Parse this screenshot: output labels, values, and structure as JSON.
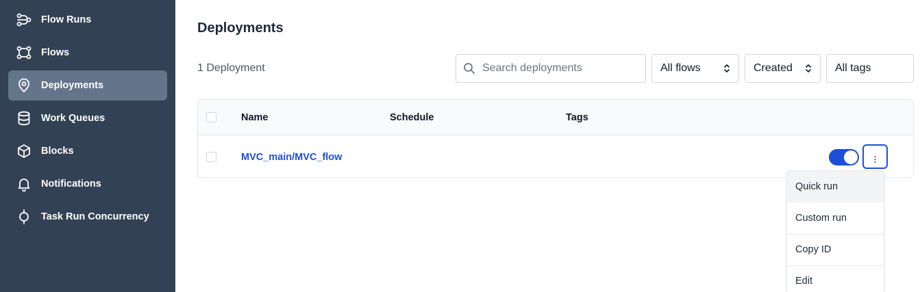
{
  "sidebar": {
    "items": [
      {
        "label": "Flow Runs",
        "icon": "flow-runs-icon"
      },
      {
        "label": "Flows",
        "icon": "flows-icon"
      },
      {
        "label": "Deployments",
        "icon": "map-pin-icon",
        "active": true
      },
      {
        "label": "Work Queues",
        "icon": "database-icon"
      },
      {
        "label": "Blocks",
        "icon": "cube-icon"
      },
      {
        "label": "Notifications",
        "icon": "bell-icon"
      },
      {
        "label": "Task Run Concurrency",
        "icon": "concurrency-icon"
      }
    ]
  },
  "main": {
    "title": "Deployments",
    "count_text": "1 Deployment",
    "search": {
      "placeholder": "Search deployments",
      "value": ""
    },
    "filters": {
      "flows": "All flows",
      "sort": "Created",
      "tags": "All tags"
    },
    "table": {
      "columns": [
        "Name",
        "Schedule",
        "Tags"
      ],
      "rows": [
        {
          "name": "MVC_main/MVC_flow",
          "schedule": "",
          "tags": "",
          "active": true
        }
      ]
    },
    "menu": {
      "items": [
        "Quick run",
        "Custom run",
        "Copy ID",
        "Edit"
      ]
    }
  },
  "colors": {
    "sidebar_bg": "#334155",
    "sidebar_active": "#64748b",
    "accent": "#1d4ed8"
  }
}
